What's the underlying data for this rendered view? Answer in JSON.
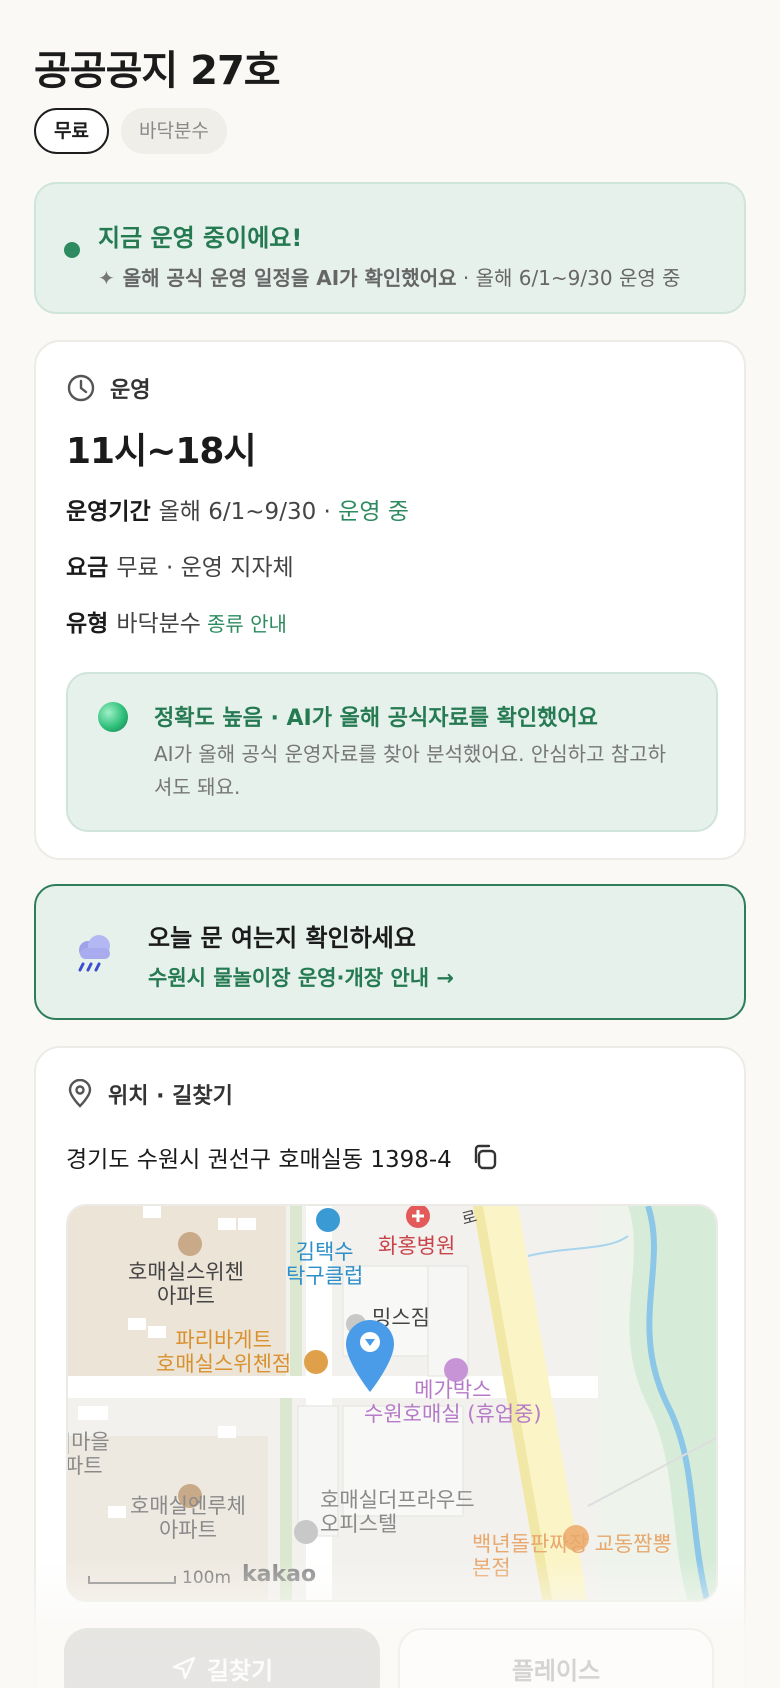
{
  "header": {
    "title": "공공공지 27호",
    "tags": [
      "무료",
      "바닥분수"
    ]
  },
  "status": {
    "title": "지금 운영 중이에요!",
    "sub_bold": "올해 공식 운영 일정을 AI가 확인했어요",
    "sub_rest": " · 올해 6/1~9/30 운영 중"
  },
  "operation": {
    "section_label": "운영",
    "hours": "11시~18시",
    "period_key": "운영기간",
    "period_value": "올해 6/1~9/30 · ",
    "period_status": "운영 중",
    "fee_key": "요금",
    "fee_value": "무료 · 운영 지자체",
    "type_key": "유형",
    "type_value": "바닥분수",
    "type_link": "종류 안내",
    "accuracy_title": "정확도 높음 · AI가 올해 공식자료를 확인했어요",
    "accuracy_desc": "AI가 올해 공식 운영자료를 찾아 분석했어요. 안심하고 참고하셔도 돼요."
  },
  "notice": {
    "title": "오늘 문 여는지 확인하세요",
    "link": "수원시 물놀이장 운영·개장 안내 →"
  },
  "location": {
    "section_label": "위치 · 길찾기",
    "address": "경기도 수원시 권선구 호매실동 1398-4",
    "map": {
      "labels": {
        "apt1": "호매실스위첸\n아파트",
        "pingpong": "김택수\n탁구클럽",
        "hospital": "화홍병원",
        "gym": "밍스짐",
        "bakery": "파리바게트\n호매실스위첸점",
        "cinema": "메가박스\n수원호매실 (휴업중)",
        "village": "|마을\n파트",
        "apt2": "호매실엔루체\n아파트",
        "office": "호매실더프라우드\n오피스텔",
        "restaurant": "백년돌판짜장 교동짬뽕\n본점",
        "road": "로"
      },
      "scale": "100m",
      "brand": "kakao"
    }
  },
  "actions": {
    "directions": "길찾기",
    "place": "플레이스"
  },
  "colors": {
    "accent_green": "#2e8b5f",
    "status_bg": "#e6f1ec",
    "marker_blue": "#4a9be8"
  }
}
